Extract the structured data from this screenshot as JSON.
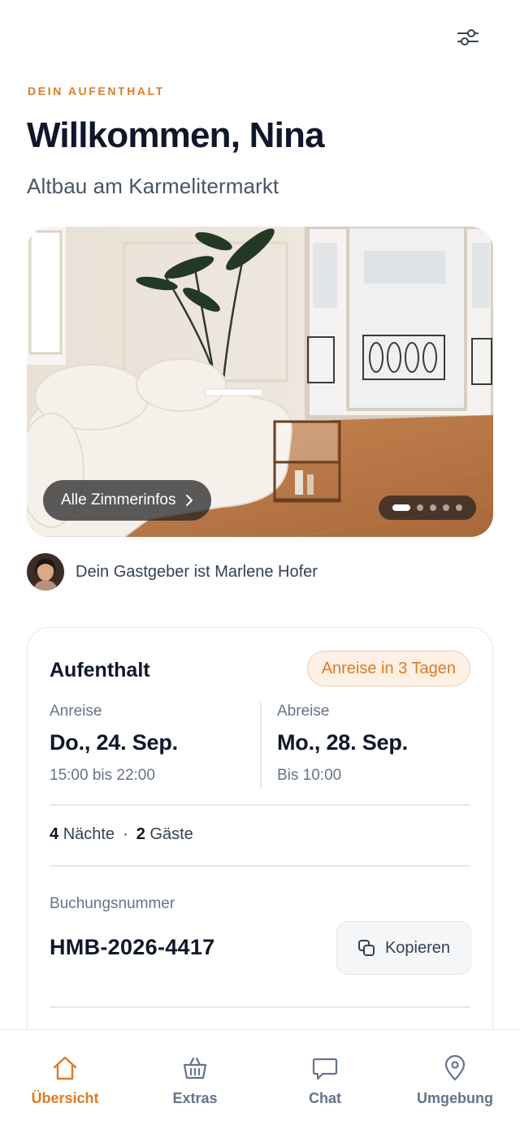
{
  "header": {
    "filter_icon": "sliders-icon",
    "eyebrow": "DEIN AUFENTHALT",
    "title": "Willkommen, Nina",
    "subtitle": "Altbau am Karmelitermarkt"
  },
  "hero": {
    "room_info_label": "Alle Zimmerinfos",
    "carousel_pages": 5,
    "carousel_active_index": 0
  },
  "host": {
    "text": "Dein Gastgeber ist Marlene Hofer"
  },
  "stay_card": {
    "title": "Aufenthalt",
    "badge": "Anreise in 3 Tagen",
    "arrival": {
      "label": "Anreise",
      "date": "Do., 24. Sep.",
      "time": "15:00 bis 22:00"
    },
    "departure": {
      "label": "Abreise",
      "date": "Mo., 28. Sep.",
      "time": "Bis 10:00"
    },
    "nights_count": "4",
    "nights_label": "Nächte",
    "separator": "·",
    "guests_count": "2",
    "guests_label": "Gäste",
    "booking_label": "Buchungsnummer",
    "booking_number": "HMB-2026-4417",
    "copy_label": "Kopieren"
  },
  "tabbar": {
    "items": [
      {
        "label": "Übersicht",
        "icon": "home-icon",
        "active": true
      },
      {
        "label": "Extras",
        "icon": "basket-icon",
        "active": false
      },
      {
        "label": "Chat",
        "icon": "chat-icon",
        "active": false
      },
      {
        "label": "Umgebung",
        "icon": "location-pin-icon",
        "active": false
      }
    ]
  },
  "colors": {
    "accent": "#e07a23",
    "text_primary": "#0f172a",
    "text_secondary": "#64748b"
  }
}
